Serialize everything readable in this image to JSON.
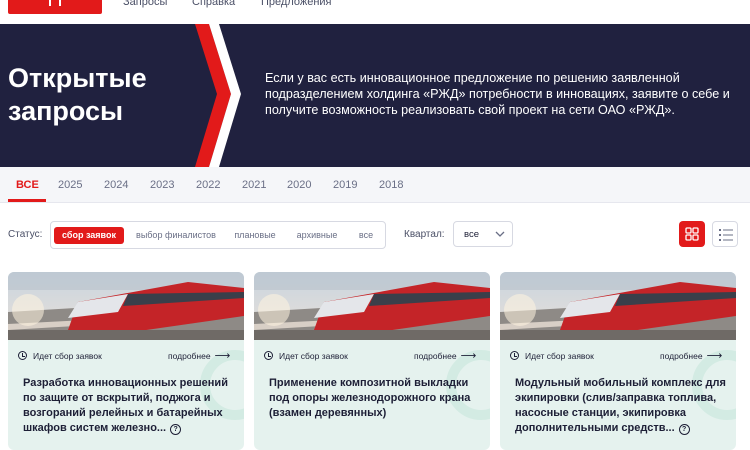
{
  "topnav": {
    "links": [
      "Запросы",
      "Справка",
      "Предложения"
    ]
  },
  "hero": {
    "title": "Открытые запросы",
    "description": "Если у вас есть инновационное предложение по решению заявленной подразделением холдинга «РЖД» потребности в инновациях, заявите о себе и получите возможность реализовать свой проект на сети ОАО «РЖД».",
    "colors": {
      "background": "#20213f",
      "accent": "#e21a1a"
    }
  },
  "years": {
    "tabs": [
      "ВСЕ",
      "2025",
      "2024",
      "2023",
      "2022",
      "2021",
      "2020",
      "2019",
      "2018"
    ],
    "active": "ВСЕ"
  },
  "filters": {
    "status_label": "Статус:",
    "status_options": [
      "сбор заявок",
      "выбор финалистов",
      "плановые",
      "архивные",
      "все"
    ],
    "status_selected": "сбор заявок",
    "quarter_label": "Квартал:",
    "quarter_value": "все",
    "view_icons": [
      "grid-view-icon",
      "list-view-icon"
    ],
    "view_selected": "grid"
  },
  "cards": [
    {
      "status": "Идет сбор заявок",
      "more": "подробнее",
      "title": "Разработка инновационных решений по защите от вскрытий, поджога и возгораний релейных и батарейных шкафов систем железно..."
    },
    {
      "status": "Идет сбор заявок",
      "more": "подробнее",
      "title": "Применение композитной выкладки под опоры железнодорожного крана (взамен деревянных)"
    },
    {
      "status": "Идет сбор заявок",
      "more": "подробнее",
      "title": "Модульный мобильный комплекс для экипировки (слив/заправка топлива, насосные станции, экипировка дополнительными средств..."
    }
  ]
}
